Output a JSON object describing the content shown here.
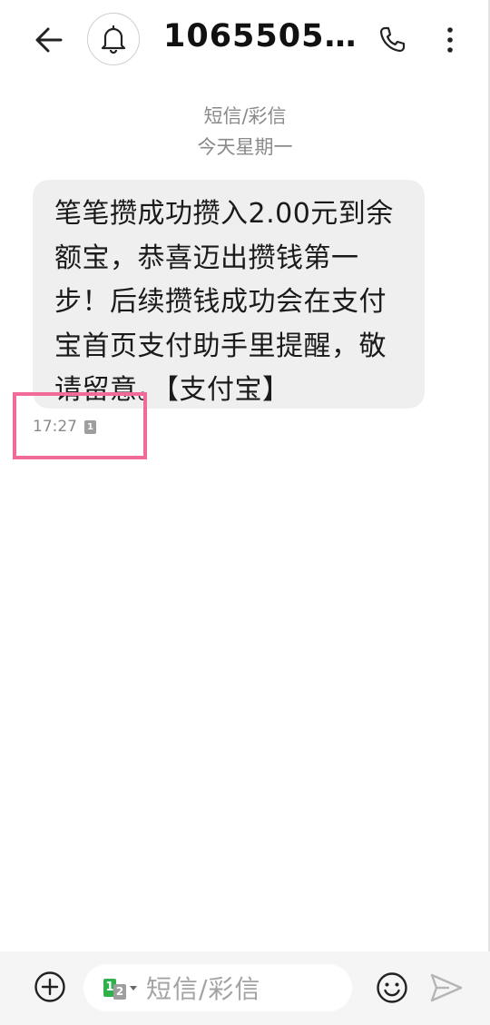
{
  "header": {
    "title": "1065505…",
    "back_icon": "arrow-left-icon",
    "bell_icon": "bell-icon",
    "call_icon": "phone-icon",
    "more_icon": "more-vertical-icon"
  },
  "conversation": {
    "type_label": "短信/彩信",
    "date_label": "今天星期一",
    "messages": [
      {
        "text": "笔笔攒成功攒入2.00元到余额宝，恭喜迈出攒钱第一步！后续攒钱成功会在支付宝首页支付助手里提醒，敬请留意。【支付宝】",
        "time": "17:27",
        "sim": "1"
      }
    ]
  },
  "composer": {
    "add_icon": "plus-circle-icon",
    "sim_primary": "1",
    "sim_secondary": "2",
    "placeholder": "短信/彩信",
    "emoji_icon": "smile-icon",
    "send_icon": "send-icon"
  },
  "colors": {
    "highlight": "#f06b9a",
    "sim1_green": "#2fb24c",
    "bubble_bg": "#efefef"
  }
}
